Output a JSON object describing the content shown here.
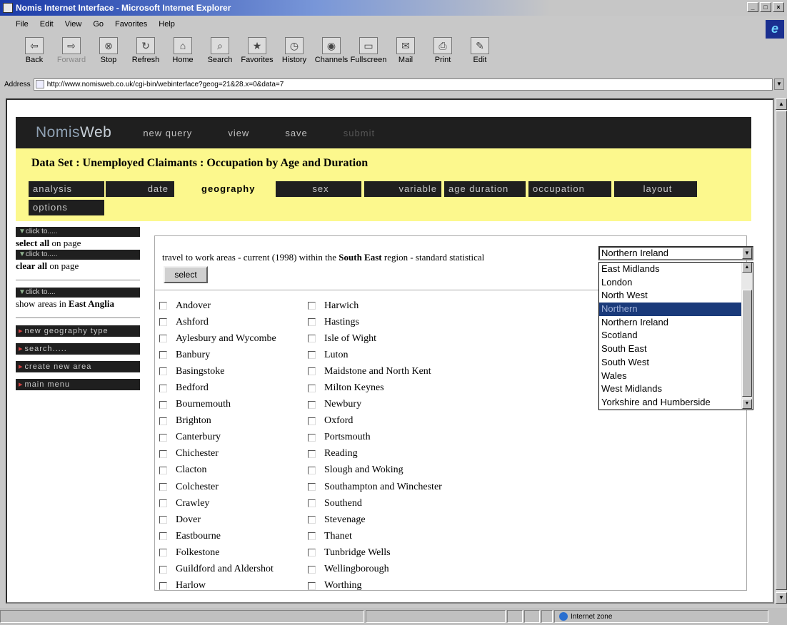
{
  "window": {
    "title": "Nomis Internet Interface - Microsoft Internet Explorer",
    "controls": [
      "_",
      "□",
      "×"
    ]
  },
  "menu": [
    "File",
    "Edit",
    "View",
    "Go",
    "Favorites",
    "Help"
  ],
  "toolbar": [
    {
      "label": "Back",
      "icon": "back-arrow-icon",
      "disabled": false
    },
    {
      "label": "Forward",
      "icon": "forward-arrow-icon",
      "disabled": true
    },
    {
      "label": "Stop",
      "icon": "stop-icon",
      "disabled": false
    },
    {
      "label": "Refresh",
      "icon": "refresh-icon",
      "disabled": false
    },
    {
      "label": "Home",
      "icon": "home-icon",
      "disabled": false
    },
    {
      "label": "Search",
      "icon": "search-icon",
      "disabled": false
    },
    {
      "label": "Favorites",
      "icon": "favorites-icon",
      "disabled": false
    },
    {
      "label": "History",
      "icon": "history-icon",
      "disabled": false
    },
    {
      "label": "Channels",
      "icon": "channels-icon",
      "disabled": false
    },
    {
      "label": "Fullscreen",
      "icon": "fullscreen-icon",
      "disabled": false
    },
    {
      "label": "Mail",
      "icon": "mail-icon",
      "disabled": false
    },
    {
      "label": "Print",
      "icon": "print-icon",
      "disabled": false
    },
    {
      "label": "Edit",
      "icon": "edit-icon",
      "disabled": false
    }
  ],
  "address": {
    "label": "Address",
    "url": "http://www.nomisweb.co.uk/cgi-bin/webinterface?geog=21&28.x=0&data=7"
  },
  "status": {
    "zone": "Internet zone"
  },
  "nomis": {
    "logo_a": "Nomis",
    "logo_b": "Web",
    "nav": [
      "new query",
      "view",
      "save",
      "submit"
    ],
    "dataset_title": "Data Set : Unemployed Claimants : Occupation by Age and Duration",
    "tabs": [
      "analysis",
      "date",
      "geography",
      "sex",
      "variable",
      "age duration",
      "occupation",
      "layout",
      "options"
    ],
    "active_tab": "geography",
    "side": {
      "click_to": "click to.....",
      "select_all_bold": "select all",
      "select_all_rest": " on page",
      "clear_all_bold": "clear all",
      "clear_all_rest": " on page",
      "click_to_short": "click to....",
      "show_areas_pre": "show areas in ",
      "show_areas_region": "East Anglia",
      "buttons": [
        "new geography type",
        "search.....",
        "create new area",
        "main menu"
      ]
    },
    "filter": {
      "text_pre": "travel to work areas - current (1998) within the ",
      "region": "South East",
      "text_post": " region - standard statistical",
      "select_label": "select",
      "combo_value": "Northern Ireland",
      "options": [
        "East Midlands",
        "London",
        "North West",
        "Northern",
        "Northern Ireland",
        "Scotland",
        "South East",
        "South West",
        "Wales",
        "West Midlands",
        "Yorkshire and Humberside"
      ],
      "highlighted": "Northern"
    },
    "areas_col1": [
      "Andover",
      "Ashford",
      "Aylesbury and Wycombe",
      "Banbury",
      "Basingstoke",
      "Bedford",
      "Bournemouth",
      "Brighton",
      "Canterbury",
      "Chichester",
      "Clacton",
      "Colchester",
      "Crawley",
      "Dover",
      "Eastbourne",
      "Folkestone",
      "Guildford and Aldershot",
      "Harlow"
    ],
    "areas_col2": [
      "Harwich",
      "Hastings",
      "Isle of Wight",
      "Luton",
      "Maidstone and North Kent",
      "Milton Keynes",
      "Newbury",
      "Oxford",
      "Portsmouth",
      "Reading",
      "Slough and Woking",
      "Southampton and Winchester",
      "Southend",
      "Stevenage",
      "Thanet",
      "Tunbridge Wells",
      "Wellingborough",
      "Worthing"
    ]
  }
}
